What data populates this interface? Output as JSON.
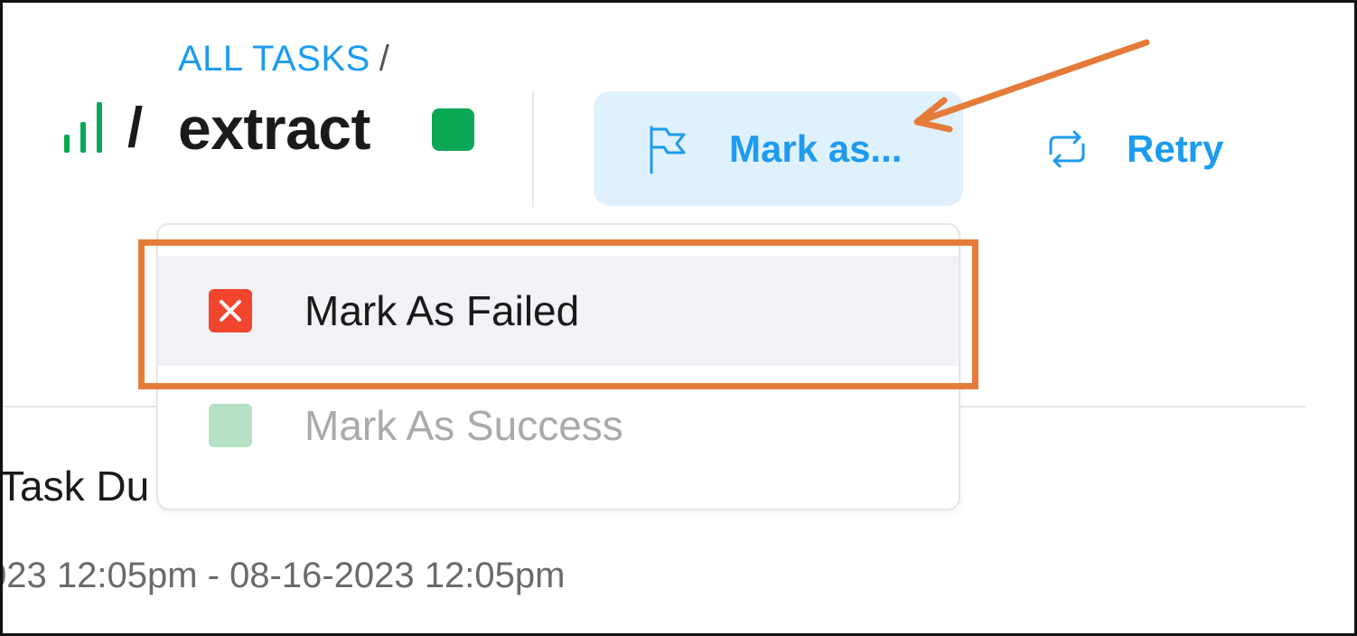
{
  "breadcrumb": {
    "root_label": "ALL TASKS",
    "separator": "/"
  },
  "header": {
    "type_icon": "bar-chart-icon",
    "separator": "/",
    "task_name": "extract",
    "status_color": "#0aa854"
  },
  "actions": {
    "mark_as": {
      "label": "Mark as...",
      "icon": "flag-icon"
    },
    "retry": {
      "label": "Retry",
      "icon": "retry-icon"
    }
  },
  "menu": {
    "items": [
      {
        "label": "Mark As Failed",
        "icon": "failed-icon",
        "color": "#f2452e"
      },
      {
        "label": "Mark As Success",
        "icon": "success-icon",
        "color": "#b6e0c4"
      }
    ]
  },
  "details": {
    "task_label": "Task Du",
    "time_range": "023 12:05pm - 08-16-2023 12:05pm"
  },
  "colors": {
    "accent": "#1d9bf0",
    "annotation": "#e57b39"
  }
}
